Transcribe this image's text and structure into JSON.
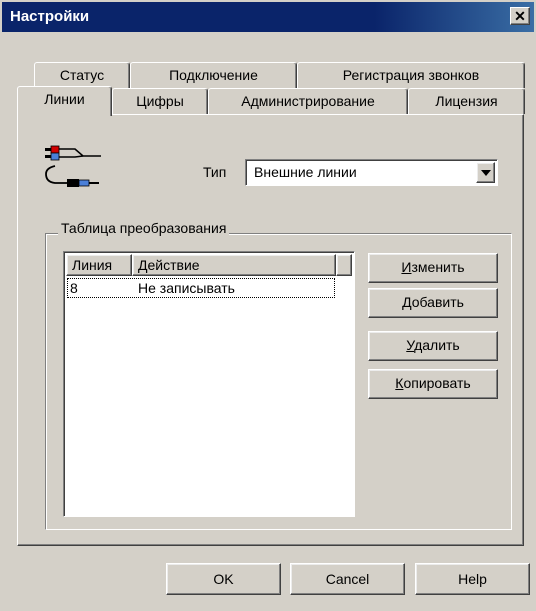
{
  "window": {
    "title": "Настройки",
    "close_glyph": "✕"
  },
  "tabs_back_row": [
    "Статус",
    "Подключение",
    "Регистрация звонков"
  ],
  "tabs_front_row": [
    "Линии",
    "Цифры",
    "Администрирование",
    "Лицензия"
  ],
  "active_tab": "Линии",
  "type_field": {
    "label": "Тип",
    "value": "Внешние линии"
  },
  "group": {
    "title": "Таблица преобразования"
  },
  "table": {
    "columns": [
      "Линия",
      "Действие"
    ],
    "rows": [
      {
        "line": "8",
        "action": "Не записывать"
      }
    ]
  },
  "side_buttons": [
    {
      "hotkey": "И",
      "rest": "зменить"
    },
    {
      "hotkey": "Д",
      "rest": "обавить"
    },
    {
      "hotkey": "У",
      "rest": "далить"
    },
    {
      "hotkey": "К",
      "rest": "опировать"
    }
  ],
  "bottom_buttons": {
    "ok": "OK",
    "cancel": "Cancel",
    "help": "Help"
  },
  "icons": {
    "lines": "cable-plugs-icon",
    "dropdown": "dropdown-arrow-icon",
    "close": "close-icon"
  }
}
